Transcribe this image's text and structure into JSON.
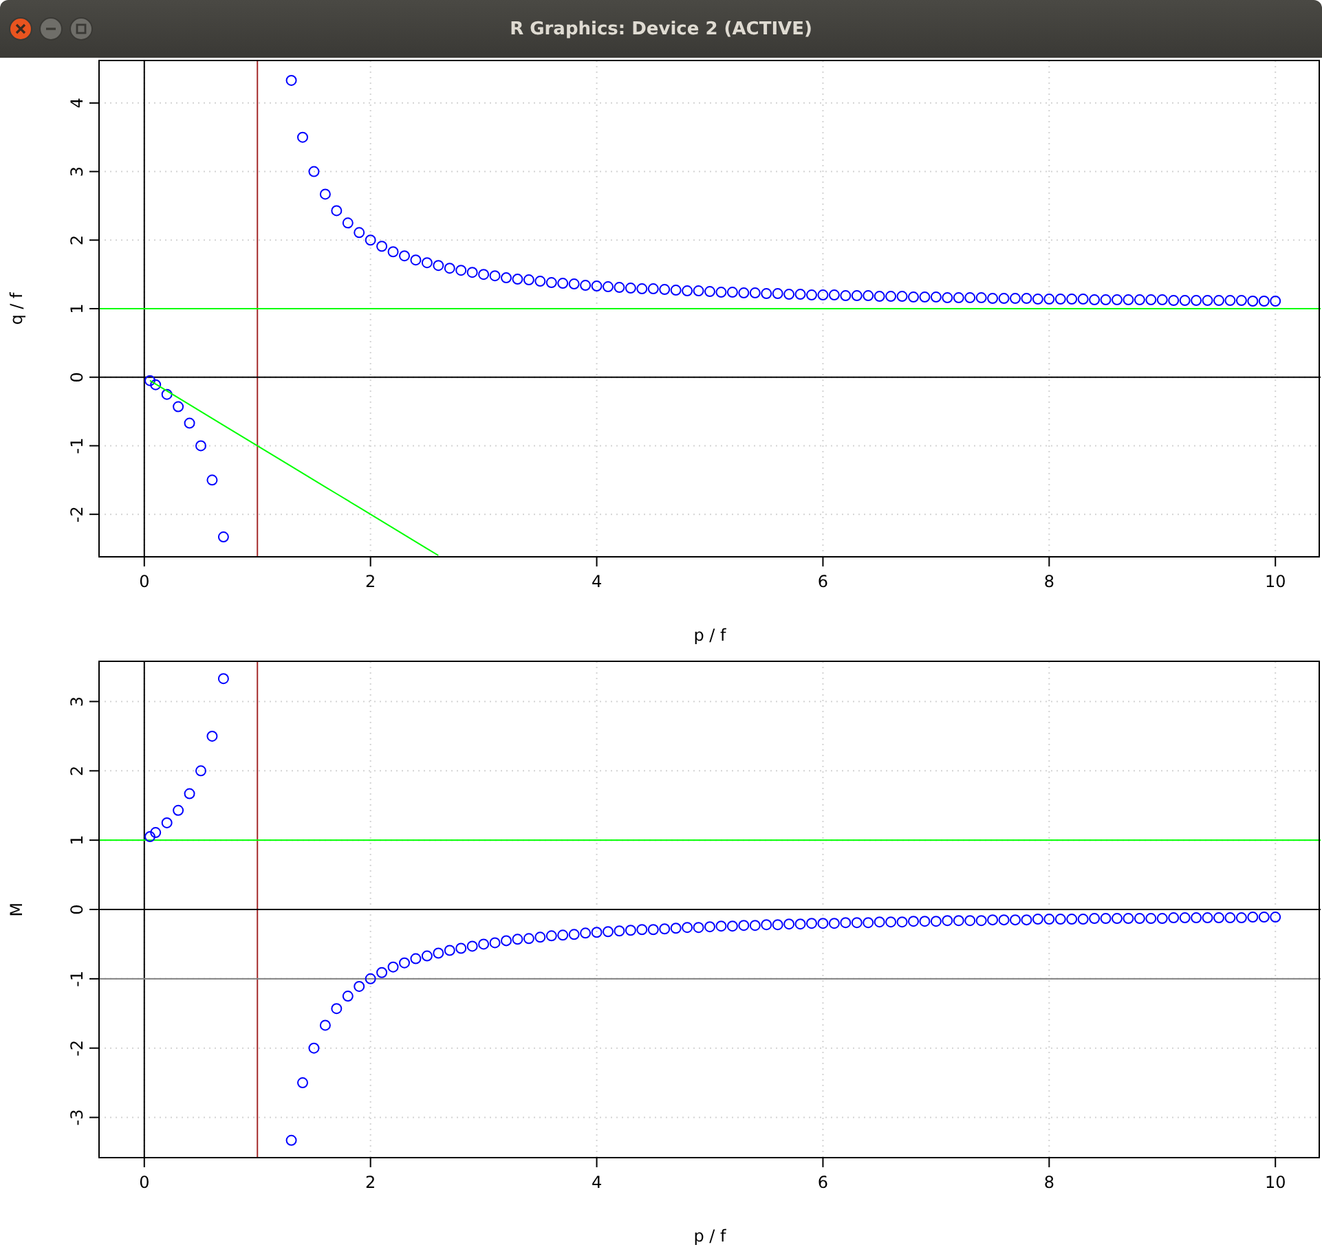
{
  "window": {
    "title": "R Graphics: Device 2 (ACTIVE)"
  },
  "plots": [
    {
      "chart_data": {
        "type": "scatter",
        "xlabel": "p / f",
        "ylabel": "q / f",
        "xlim": [
          -0.4,
          10.4
        ],
        "ylim": [
          -2.62,
          4.62
        ],
        "xticks": [
          0,
          2,
          4,
          6,
          8,
          10
        ],
        "yticks": [
          -2,
          -1,
          0,
          1,
          2,
          3,
          4
        ],
        "grid": true,
        "x": [
          0.05,
          0.1,
          0.2,
          0.3,
          0.4,
          0.5,
          0.6,
          0.7,
          1.3,
          1.4,
          1.5,
          1.6,
          1.7,
          1.8,
          1.9,
          2,
          2.1,
          2.2,
          2.3,
          2.4,
          2.5,
          2.6,
          2.7,
          2.8,
          2.9,
          3,
          3.1,
          3.2,
          3.3,
          3.4,
          3.5,
          3.6,
          3.7,
          3.8,
          3.9,
          4,
          4.1,
          4.2,
          4.3,
          4.4,
          4.5,
          4.6,
          4.7,
          4.8,
          4.9,
          5,
          5.1,
          5.2,
          5.3,
          5.4,
          5.5,
          5.6,
          5.7,
          5.8,
          5.9,
          6,
          6.1,
          6.2,
          6.3,
          6.4,
          6.5,
          6.6,
          6.7,
          6.8,
          6.9,
          7,
          7.1,
          7.2,
          7.3,
          7.4,
          7.5,
          7.6,
          7.7,
          7.8,
          7.9,
          8,
          8.1,
          8.2,
          8.3,
          8.4,
          8.5,
          8.6,
          8.7,
          8.8,
          8.9,
          9,
          9.1,
          9.2,
          9.3,
          9.4,
          9.5,
          9.6,
          9.7,
          9.8,
          9.9,
          10
        ],
        "series": [
          {
            "color": "#0000ff",
            "values": [
              -0.05,
              -0.11,
              -0.25,
              -0.43,
              -0.67,
              -1,
              -1.5,
              -2.33,
              4.33,
              3.5,
              3,
              2.67,
              2.43,
              2.25,
              2.11,
              2,
              1.91,
              1.83,
              1.77,
              1.71,
              1.67,
              1.63,
              1.59,
              1.56,
              1.53,
              1.5,
              1.48,
              1.45,
              1.43,
              1.42,
              1.4,
              1.38,
              1.37,
              1.36,
              1.34,
              1.33,
              1.32,
              1.31,
              1.3,
              1.29,
              1.29,
              1.28,
              1.27,
              1.26,
              1.26,
              1.25,
              1.24,
              1.24,
              1.23,
              1.23,
              1.22,
              1.22,
              1.21,
              1.21,
              1.2,
              1.2,
              1.2,
              1.19,
              1.19,
              1.19,
              1.18,
              1.18,
              1.18,
              1.17,
              1.17,
              1.17,
              1.16,
              1.16,
              1.16,
              1.16,
              1.15,
              1.15,
              1.15,
              1.15,
              1.14,
              1.14,
              1.14,
              1.14,
              1.14,
              1.13,
              1.13,
              1.13,
              1.13,
              1.13,
              1.13,
              1.13,
              1.12,
              1.12,
              1.12,
              1.12,
              1.12,
              1.12,
              1.12,
              1.11,
              1.11,
              1.11
            ]
          },
          {
            "type": "line",
            "color": "#00ff00",
            "values": [
              -0.05,
              -0.1,
              -0.2,
              -0.3,
              -0.4,
              -0.5,
              -0.6,
              -0.7,
              -1.3,
              -1.4,
              -1.5,
              -1.6,
              -1.7,
              -1.8,
              -1.9,
              -2,
              -2.1,
              -2.2,
              -2.3,
              -2.4,
              -2.5,
              -2.6,
              null,
              null,
              null,
              null,
              null,
              null,
              null,
              null,
              null,
              null,
              null,
              null,
              null,
              null,
              null,
              null,
              null,
              null,
              null,
              null,
              null,
              null,
              null,
              null,
              null,
              null,
              null,
              null,
              null,
              null,
              null,
              null,
              null,
              null,
              null,
              null,
              null,
              null,
              null,
              null,
              null,
              null,
              null,
              null,
              null,
              null,
              null,
              null,
              null,
              null,
              null,
              null,
              null,
              null,
              null,
              null,
              null,
              null,
              null,
              null,
              null,
              null,
              null,
              null,
              null,
              null,
              null,
              null,
              null,
              null,
              null,
              null,
              null,
              null
            ]
          }
        ],
        "ref_lines": [
          {
            "axis": "x",
            "value": 0,
            "color": "#000000"
          },
          {
            "axis": "x",
            "value": 1,
            "color": "#a52a2a"
          },
          {
            "axis": "y",
            "value": 0,
            "color": "#000000"
          },
          {
            "axis": "y",
            "value": 1,
            "color": "#00ff00"
          }
        ]
      }
    },
    {
      "chart_data": {
        "type": "scatter",
        "xlabel": "p / f",
        "ylabel": "M",
        "xlim": [
          -0.4,
          10.4
        ],
        "ylim": [
          -3.58,
          3.58
        ],
        "xticks": [
          0,
          2,
          4,
          6,
          8,
          10
        ],
        "yticks": [
          -3,
          -2,
          -1,
          0,
          1,
          2,
          3
        ],
        "grid": true,
        "x": [
          0.05,
          0.1,
          0.2,
          0.3,
          0.4,
          0.5,
          0.6,
          0.7,
          1.3,
          1.4,
          1.5,
          1.6,
          1.7,
          1.8,
          1.9,
          2,
          2.1,
          2.2,
          2.3,
          2.4,
          2.5,
          2.6,
          2.7,
          2.8,
          2.9,
          3,
          3.1,
          3.2,
          3.3,
          3.4,
          3.5,
          3.6,
          3.7,
          3.8,
          3.9,
          4,
          4.1,
          4.2,
          4.3,
          4.4,
          4.5,
          4.6,
          4.7,
          4.8,
          4.9,
          5,
          5.1,
          5.2,
          5.3,
          5.4,
          5.5,
          5.6,
          5.7,
          5.8,
          5.9,
          6,
          6.1,
          6.2,
          6.3,
          6.4,
          6.5,
          6.6,
          6.7,
          6.8,
          6.9,
          7,
          7.1,
          7.2,
          7.3,
          7.4,
          7.5,
          7.6,
          7.7,
          7.8,
          7.9,
          8,
          8.1,
          8.2,
          8.3,
          8.4,
          8.5,
          8.6,
          8.7,
          8.8,
          8.9,
          9,
          9.1,
          9.2,
          9.3,
          9.4,
          9.5,
          9.6,
          9.7,
          9.8,
          9.9,
          10
        ],
        "series": [
          {
            "color": "#0000ff",
            "values": [
              1.05,
              1.11,
              1.25,
              1.43,
              1.67,
              2,
              2.5,
              3.33,
              -3.33,
              -2.5,
              -2,
              -1.67,
              -1.43,
              -1.25,
              -1.11,
              -1,
              -0.91,
              -0.83,
              -0.77,
              -0.71,
              -0.67,
              -0.63,
              -0.59,
              -0.56,
              -0.53,
              -0.5,
              -0.48,
              -0.45,
              -0.43,
              -0.42,
              -0.4,
              -0.38,
              -0.37,
              -0.36,
              -0.34,
              -0.33,
              -0.32,
              -0.31,
              -0.3,
              -0.29,
              -0.29,
              -0.28,
              -0.27,
              -0.26,
              -0.26,
              -0.25,
              -0.24,
              -0.24,
              -0.23,
              -0.23,
              -0.22,
              -0.22,
              -0.21,
              -0.21,
              -0.2,
              -0.2,
              -0.2,
              -0.19,
              -0.19,
              -0.19,
              -0.18,
              -0.18,
              -0.18,
              -0.17,
              -0.17,
              -0.17,
              -0.16,
              -0.16,
              -0.16,
              -0.16,
              -0.15,
              -0.15,
              -0.15,
              -0.15,
              -0.14,
              -0.14,
              -0.14,
              -0.14,
              -0.14,
              -0.13,
              -0.13,
              -0.13,
              -0.13,
              -0.13,
              -0.13,
              -0.13,
              -0.12,
              -0.12,
              -0.12,
              -0.12,
              -0.12,
              -0.12,
              -0.12,
              -0.11,
              -0.11,
              -0.11
            ]
          }
        ],
        "ref_lines": [
          {
            "axis": "x",
            "value": 0,
            "color": "#000000"
          },
          {
            "axis": "x",
            "value": 1,
            "color": "#a52a2a"
          },
          {
            "axis": "y",
            "value": 0,
            "color": "#000000"
          },
          {
            "axis": "y",
            "value": 1,
            "color": "#00ff00"
          },
          {
            "axis": "y",
            "value": -1,
            "color": "#808080"
          }
        ]
      }
    }
  ]
}
